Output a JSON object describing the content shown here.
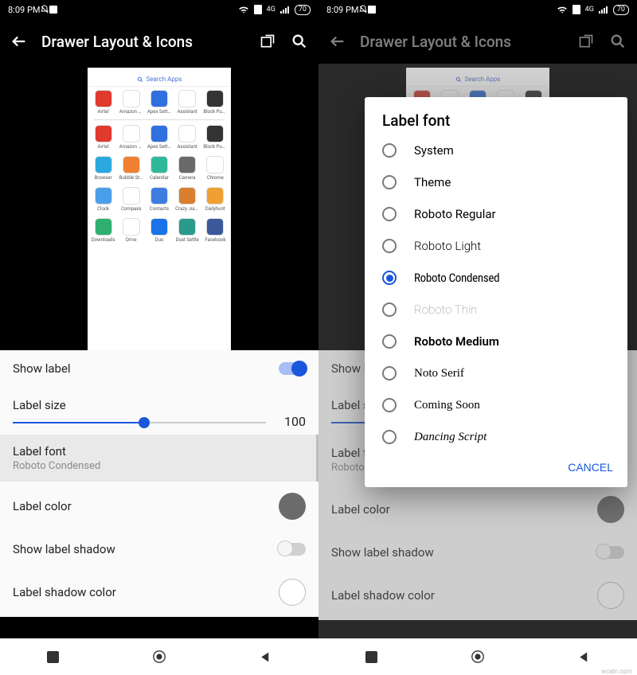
{
  "status": {
    "time": "8:09 PM",
    "net": "4G",
    "batt": "70"
  },
  "appbar": {
    "title": "Drawer Layout & Icons"
  },
  "drawer": {
    "search": "Search Apps",
    "rows": [
      [
        "Airtel",
        "Amazon Sh…",
        "Apex Settin…",
        "Assistant",
        "Block Puzzl…"
      ],
      [
        "Airtel",
        "Amazon Sh…",
        "Apex Settin…",
        "Assistant",
        "Block Puzzl…"
      ],
      [
        "Browser",
        "Bubble Story",
        "Calendar",
        "Camera",
        "Chrome"
      ],
      [
        "Clock",
        "Compass",
        "Contacts",
        "Crazy Juicer",
        "Dailyhunt"
      ],
      [
        "Downloads",
        "Drive",
        "Duo",
        "Dust Settle",
        "Facebook"
      ]
    ],
    "colors": [
      [
        "#e03a2f",
        "#fff",
        "#2f6fe0",
        "#fff",
        "#333"
      ],
      [
        "#e03a2f",
        "#fff",
        "#2f6fe0",
        "#fff",
        "#333"
      ],
      [
        "#2aa9e0",
        "#f08030",
        "#2fb99a",
        "#6a6a6a",
        "#fff"
      ],
      [
        "#4aa0e8",
        "#fff",
        "#3d7de0",
        "#d97f2f",
        "#f0a030"
      ],
      [
        "#2fb070",
        "#fff",
        "#1a73e8",
        "#2a9a8a",
        "#3b5998"
      ]
    ]
  },
  "settings": {
    "showLabel": "Show label",
    "labelSize": "Label size",
    "labelSizeValue": "100",
    "labelFont": "Label font",
    "labelFontValue": "Roboto Condensed",
    "labelColor": "Label color",
    "showShadow": "Show label shadow",
    "shadowColor": "Label shadow color"
  },
  "dialog": {
    "title": "Label font",
    "options": [
      "System",
      "Theme",
      "Roboto Regular",
      "Roboto Light",
      "Roboto Condensed",
      "Roboto Thin",
      "Roboto Medium",
      "Noto Serif",
      "Coming Soon",
      "Dancing Script"
    ],
    "selected": 4,
    "cancel": "CANCEL"
  },
  "watermark": "wcaln.com"
}
